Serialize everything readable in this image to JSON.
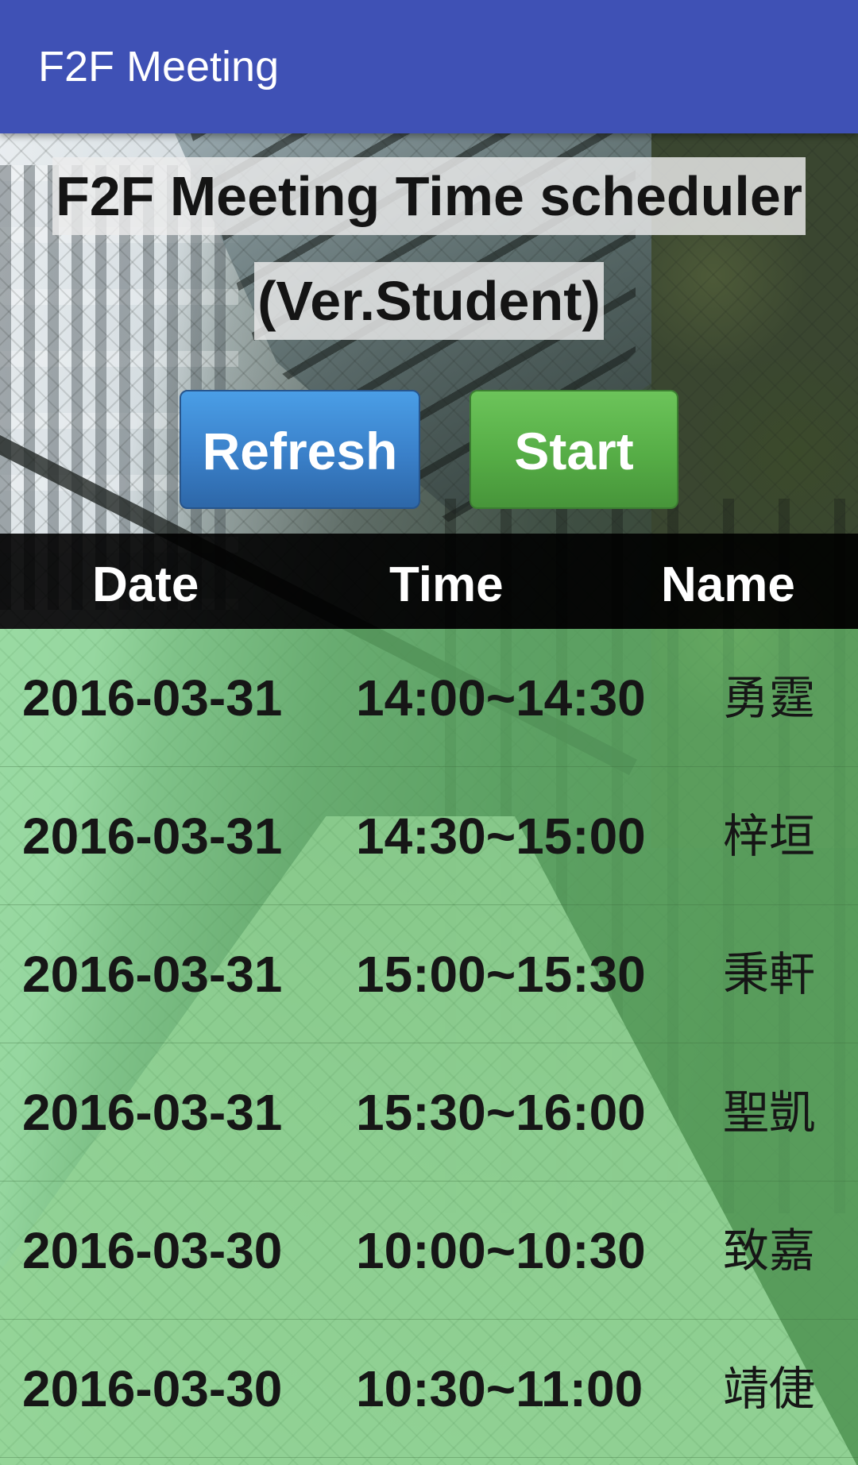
{
  "app": {
    "title": "F2F Meeting"
  },
  "header": {
    "title_line1": "F2F Meeting Time scheduler",
    "title_line2": "(Ver.Student)"
  },
  "buttons": {
    "refresh_label": "Refresh",
    "start_label": "Start"
  },
  "table": {
    "columns": [
      "Date",
      "Time",
      "Name"
    ],
    "rows": [
      {
        "date": "2016-03-31",
        "time": "14:00~14:30",
        "name": "勇霆"
      },
      {
        "date": "2016-03-31",
        "time": "14:30~15:00",
        "name": "梓垣"
      },
      {
        "date": "2016-03-31",
        "time": "15:00~15:30",
        "name": "秉軒"
      },
      {
        "date": "2016-03-31",
        "time": "15:30~16:00",
        "name": "聖凱"
      },
      {
        "date": "2016-03-30",
        "time": "10:00~10:30",
        "name": "致嘉"
      },
      {
        "date": "2016-03-30",
        "time": "10:30~11:00",
        "name": "靖倢"
      }
    ]
  },
  "colors": {
    "appbar": "#3f51b5",
    "refresh_button": "#3a80c9",
    "start_button": "#56ad46",
    "table_header": "#000000",
    "table_rows": "#70d478"
  }
}
